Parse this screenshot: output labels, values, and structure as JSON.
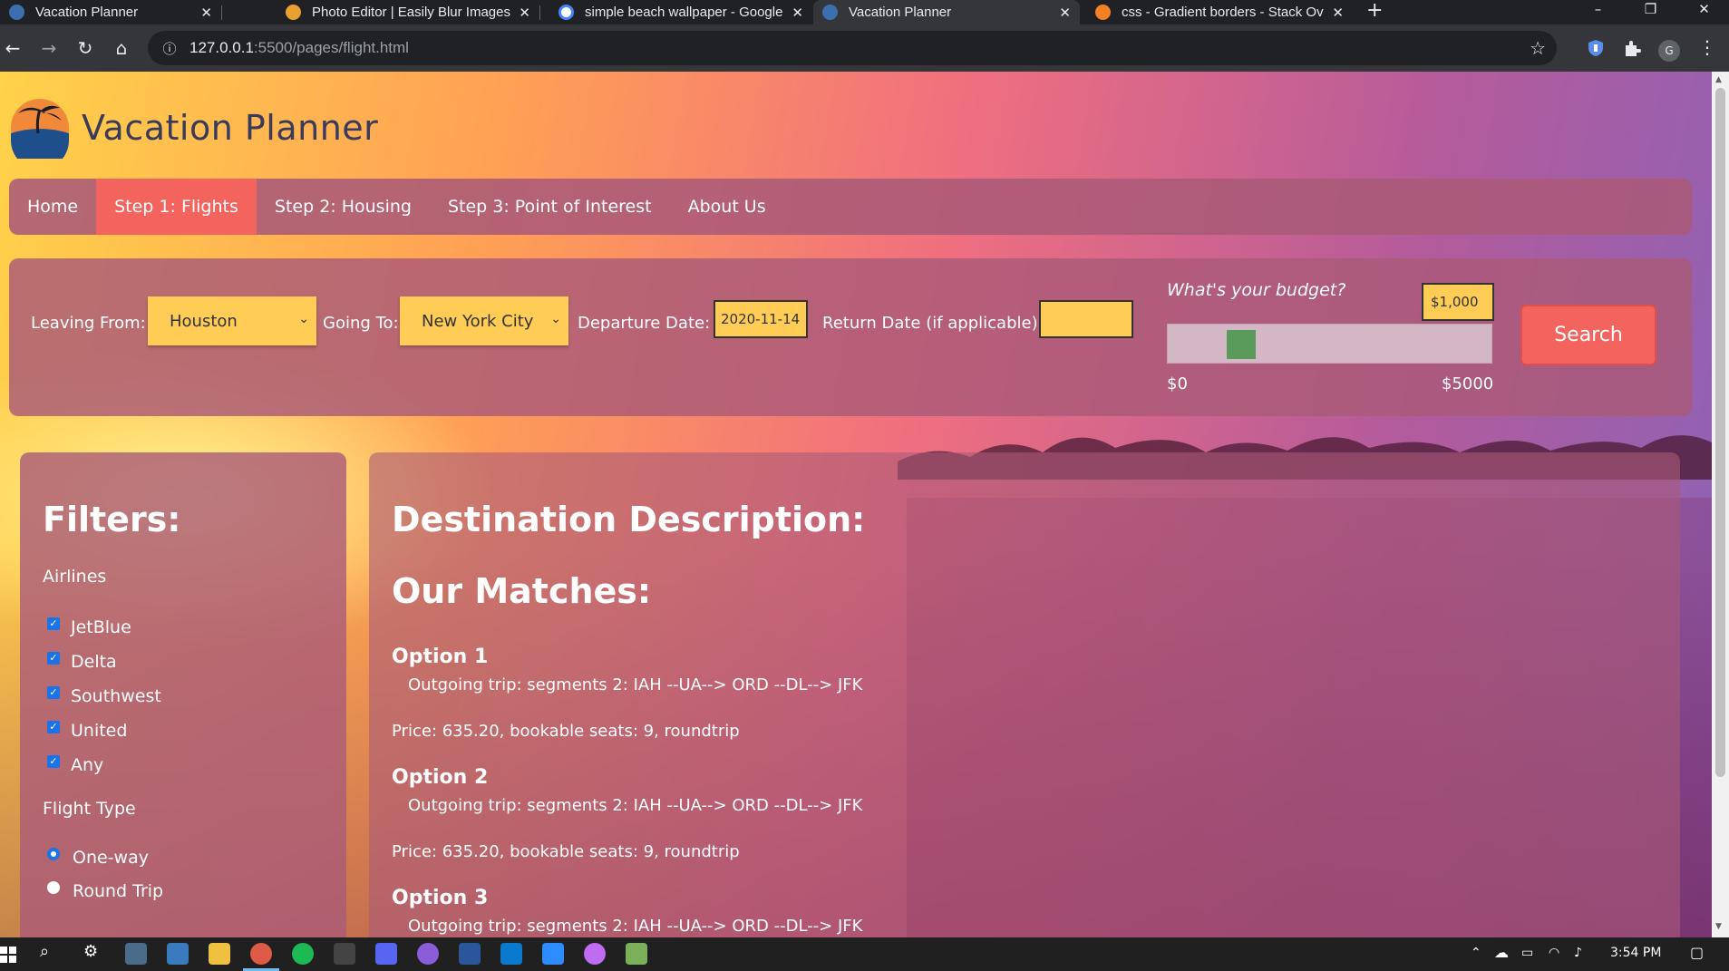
{
  "browser": {
    "tabs": [
      {
        "title": "Vacation Planner",
        "active": false
      },
      {
        "title": "Photo Editor | Easily Blur Images",
        "active": false
      },
      {
        "title": "simple beach wallpaper - Google",
        "active": false
      },
      {
        "title": "Vacation Planner",
        "active": true
      },
      {
        "title": "css - Gradient borders - Stack Ov",
        "active": false
      }
    ],
    "new_tab": "+",
    "window_controls": [
      "–",
      "❐",
      "✕"
    ],
    "url_host": "127.0.0.1",
    "url_path": ":5500/pages/flight.html",
    "profile_initial": "G"
  },
  "site": {
    "title": "Vacation Planner",
    "nav": [
      {
        "label": "Home"
      },
      {
        "label": "Step 1: Flights"
      },
      {
        "label": "Step 2: Housing"
      },
      {
        "label": "Step 3: Point of Interest"
      },
      {
        "label": "About Us"
      }
    ],
    "active_nav": "Step 1: Flights"
  },
  "search": {
    "leaving_label": "Leaving From:",
    "leaving_value": "Houston",
    "going_label": "Going To:",
    "going_value": "New York City",
    "departure_label": "Departure Date:",
    "departure_value": "2020-11-14",
    "return_label": "Return Date (if applicable):",
    "return_value": "",
    "budget_question": "What's your budget?",
    "budget_value": "$1,000",
    "budget_min": "$0",
    "budget_max": "$5000",
    "budget_fraction": 0.2,
    "search_label": "Search"
  },
  "filters": {
    "heading": "Filters:",
    "airlines_label": "Airlines",
    "airlines": [
      {
        "label": "JetBlue",
        "checked": true
      },
      {
        "label": "Delta",
        "checked": true
      },
      {
        "label": "Southwest",
        "checked": true
      },
      {
        "label": "United",
        "checked": true
      },
      {
        "label": "Any",
        "checked": true
      }
    ],
    "flight_type_label": "Flight Type",
    "flight_types": [
      {
        "label": "One-way",
        "selected": true
      },
      {
        "label": "Round Trip",
        "selected": false
      }
    ]
  },
  "results": {
    "destination_heading": "Destination Description:",
    "matches_heading": "Our Matches:",
    "options": [
      {
        "title": "Option 1",
        "trip": "Outgoing trip: segments 2: IAH --UA--> ORD --DL--> JFK",
        "price": "Price: 635.20, bookable seats: 9, roundtrip"
      },
      {
        "title": "Option 2",
        "trip": "Outgoing trip: segments 2: IAH --UA--> ORD --DL--> JFK",
        "price": "Price: 635.20, bookable seats: 9, roundtrip"
      },
      {
        "title": "Option 3",
        "trip": "Outgoing trip: segments 2: IAH --UA--> ORD --DL--> JFK"
      }
    ]
  },
  "taskbar": {
    "clock": "3:54 PM"
  },
  "colors": {
    "accent": "#f4645e",
    "input_bg": "#ffcc55",
    "panel": "#aa5a78",
    "slider_thumb": "#5a9a5a"
  }
}
